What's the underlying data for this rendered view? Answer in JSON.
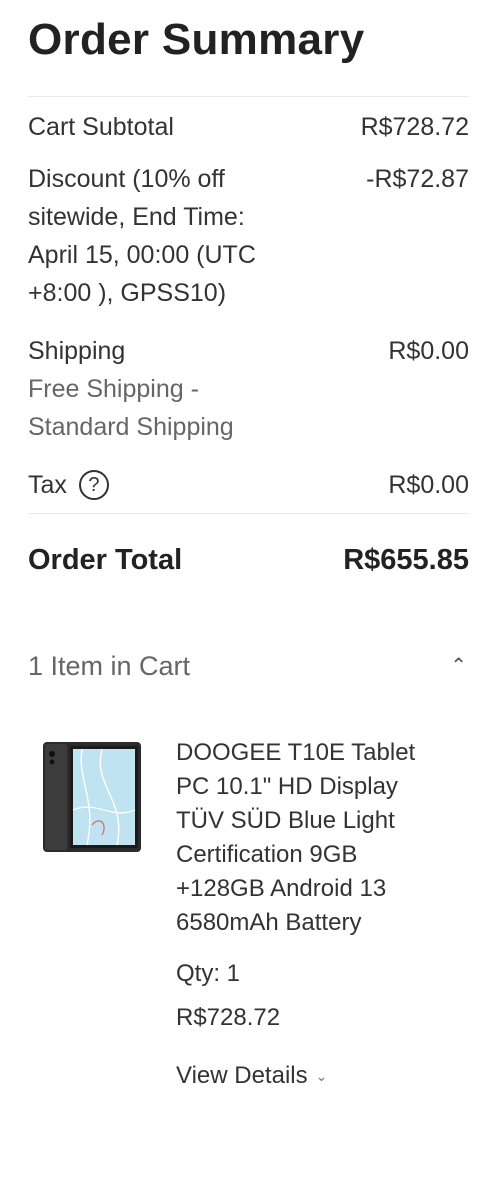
{
  "summary": {
    "title": "Order Summary",
    "subtotal_label": "Cart Subtotal",
    "subtotal_value": "R$728.72",
    "discount_label": "Discount (10% off sitewide, End Time: April 15, 00:00 (UTC +8:00 ), GPSS10)",
    "discount_value": "-R$72.87",
    "shipping_label": "Shipping",
    "shipping_method": "Free Shipping - Standard Shipping",
    "shipping_value": "R$0.00",
    "tax_label": "Tax",
    "tax_help_icon": "?",
    "tax_value": "R$0.00",
    "total_label": "Order Total",
    "total_value": "R$655.85"
  },
  "cart": {
    "header": "1 Item in Cart",
    "collapse_icon": "chevron-up-icon",
    "items": [
      {
        "name": "DOOGEE T10E Tablet PC 10.1\" HD Display TÜV SÜD Blue Light Certification 9GB +128GB Android 13 6580mAh Battery",
        "qty": "Qty: 1",
        "price": "R$728.72",
        "view_details": "View Details"
      }
    ]
  },
  "colors": {
    "text": "#333333",
    "muted": "#666666",
    "divider": "#e8e8e8"
  }
}
